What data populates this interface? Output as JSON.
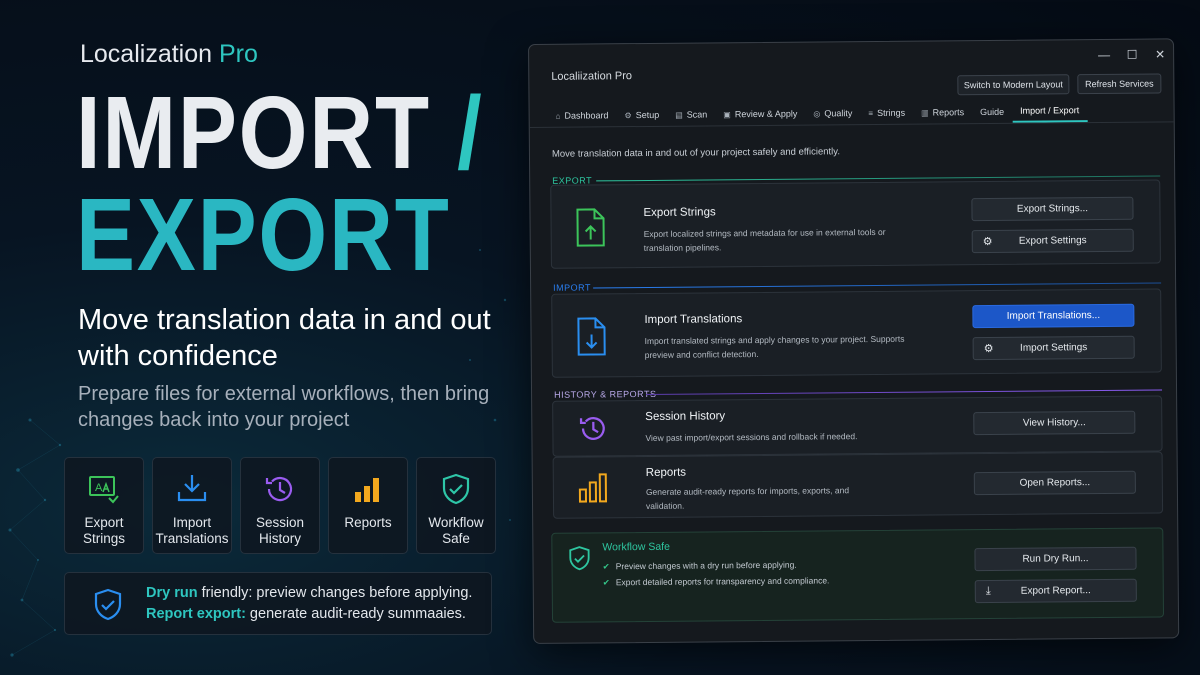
{
  "promo": {
    "brand_main": "Localization",
    "brand_accent": "Pro",
    "hero_line1": "IMPORT",
    "hero_slash": "/",
    "hero_line2": "EXPORT",
    "headline": "Move translation data in and out with confidence",
    "subheadline": "Prepare files for external workflows, then bring changes back into your project",
    "features": [
      {
        "icon": "export-strings-icon",
        "label": "Export Strings",
        "color": "#3cc45a"
      },
      {
        "icon": "download-icon",
        "label": "Import Translations",
        "color": "#2a8ef0"
      },
      {
        "icon": "history-icon",
        "label": "Session History",
        "color": "#9a5cf0"
      },
      {
        "icon": "bar-chart-icon",
        "label": "Reports",
        "color": "#f2a81e"
      },
      {
        "icon": "shield-check-icon",
        "label": "Workflow Safe",
        "color": "#2ec6a8"
      }
    ],
    "info": {
      "line1_highlight": "Dry run",
      "line1_rest": " friendly: preview changes before applying.",
      "line2_highlight": "Report export:",
      "line2_rest": " generate audit-ready summaaies."
    }
  },
  "app": {
    "title": "Localiization Pro",
    "controls": {
      "minimize": "—",
      "maximize": "☐",
      "close": "✕"
    },
    "top_buttons": {
      "modern": "Switch to Modern Layout",
      "refresh": "Refresh Services"
    },
    "tabs": [
      {
        "icon": "⌂",
        "label": "Dashboard"
      },
      {
        "icon": "⚙",
        "label": "Setup"
      },
      {
        "icon": "▤",
        "label": "Scan"
      },
      {
        "icon": "▣",
        "label": "Review & Apply"
      },
      {
        "icon": "◎",
        "label": "Quality"
      },
      {
        "icon": "≡",
        "label": "Strings"
      },
      {
        "icon": "▥",
        "label": "Reports"
      },
      {
        "icon": "",
        "label": "Guide"
      },
      {
        "icon": "",
        "label": "Import / Export"
      }
    ],
    "active_tab": "Import / Export",
    "intro": "Move translation data in and out of your project safely and efficiently.",
    "sections": {
      "export": {
        "label": "EXPORT",
        "color": "#2ec6a0",
        "title": "Export Strings",
        "desc": "Export localized strings and metadata for use in external tools or translation pipelines.",
        "btn1": "Export Strings...",
        "btn2": "Export Settings"
      },
      "import": {
        "label": "IMPORT",
        "color": "#2a7ef0",
        "title": "Import Translations",
        "desc": "Import translated strings and apply changes to your project. Supports preview and conflict detection.",
        "btn1": "Import Translations...",
        "btn2": "Import Settings"
      },
      "history": {
        "label": "HISTORY & REPORTS",
        "color": "#8a5cf0",
        "session_title": "Session History",
        "session_desc": "View past import/export sessions and rollback if needed.",
        "session_btn": "View History...",
        "reports_title": "Reports",
        "reports_desc": "Generate audit-ready reports for imports, exports, and validation.",
        "reports_btn": "Open Reports..."
      },
      "workflow": {
        "title": "Workflow Safe",
        "item1": "Preview changes with a dry run before applying.",
        "item2": "Export detailed reports for transparency and compliance.",
        "btn1": "Run Dry Run...",
        "btn2": "Export Report..."
      }
    }
  }
}
